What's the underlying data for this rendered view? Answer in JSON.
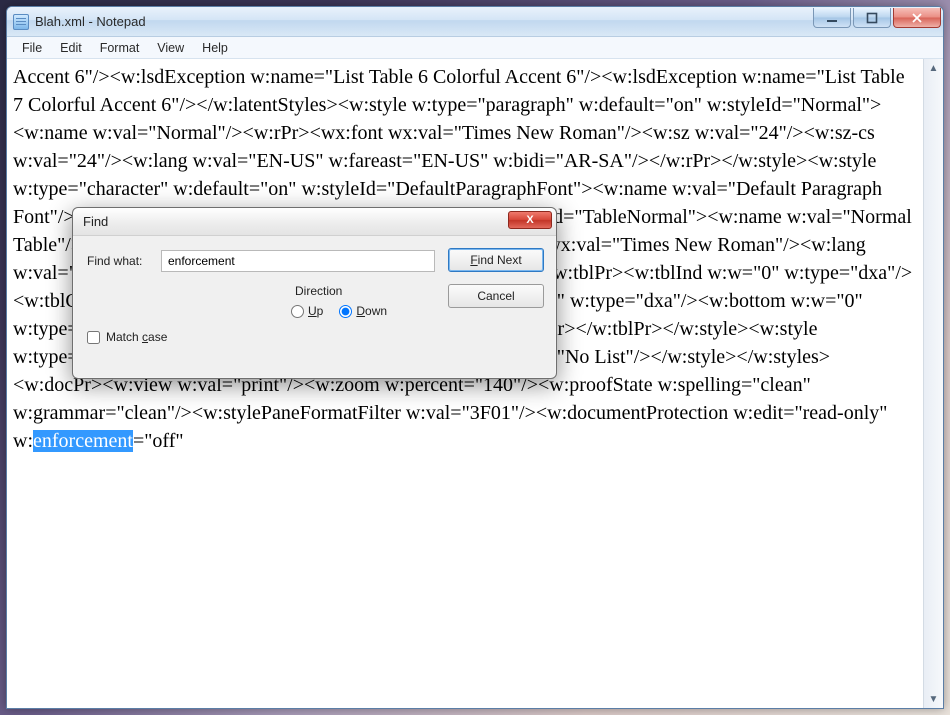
{
  "window": {
    "title": "Blah.xml - Notepad"
  },
  "menu": {
    "file": "File",
    "edit": "Edit",
    "format": "Format",
    "view": "View",
    "help": "Help"
  },
  "editor": {
    "text_before_highlight": "Accent 6\"/><w:lsdException w:name=\"List Table 6 Colorful Accent 6\"/><w:lsdException w:name=\"List Table 7 Colorful Accent 6\"/></w:latentStyles><w:style w:type=\"paragraph\" w:default=\"on\" w:styleId=\"Normal\"><w:name w:val=\"Normal\"/><w:rPr><wx:font wx:val=\"Times New Roman\"/><w:sz w:val=\"24\"/><w:sz-cs w:val=\"24\"/><w:lang w:val=\"EN-US\" w:fareast=\"EN-US\" w:bidi=\"AR-SA\"/></w:rPr></w:style><w:style w:type=\"character\" w:default=\"on\" w:styleId=\"DefaultParagraphFont\"><w:name w:val=\"Default Paragraph Font\"/></w:style><w:style w:type=\"table\" w:default=\"on\" w:styleId=\"TableNormal\"><w:name w:val=\"Normal Table\"/><wx:uiName wx:val=\"Table Normal\"/><w:rPr><wx:font wx:val=\"Times New Roman\"/><w:lang w:val=\"EN-US\" w:fareast=\"EN-US\" w:bidi=\"AR-SA\"/></w:rPr><w:tblPr><w:tblInd w:w=\"0\" w:type=\"dxa\"/><w:tblCellMar><w:top w:w=\"0\" w:type=\"dxa\"/><w:left w:w=\"108\" w:type=\"dxa\"/><w:bottom w:w=\"0\" w:type=\"dxa\"/><w:right w:w=\"108\" w:type=\"dxa\"/></w:tblCellMar></w:tblPr></w:style><w:style w:type=\"list\" w:default=\"on\" w:styleId=\"NoList\"><w:name w:val=\"No List\"/></w:style></w:styles><w:docPr><w:view w:val=\"print\"/><w:zoom w:percent=\"140\"/><w:proofState w:spelling=\"clean\" w:grammar=\"clean\"/><w:stylePaneFormatFilter w:val=\"3F01\"/><w:documentProtection w:edit=\"read-only\" w:",
    "highlight": "enforcement",
    "text_after_highlight": "=\"off\""
  },
  "find": {
    "title": "Find",
    "find_what_label": "Find what:",
    "find_what_value": "enforcement",
    "find_next": "Find Next",
    "cancel": "Cancel",
    "direction_label": "Direction",
    "up": "Up",
    "down": "Down",
    "match_case": "Match case",
    "selected_direction": "down",
    "match_case_checked": false
  }
}
